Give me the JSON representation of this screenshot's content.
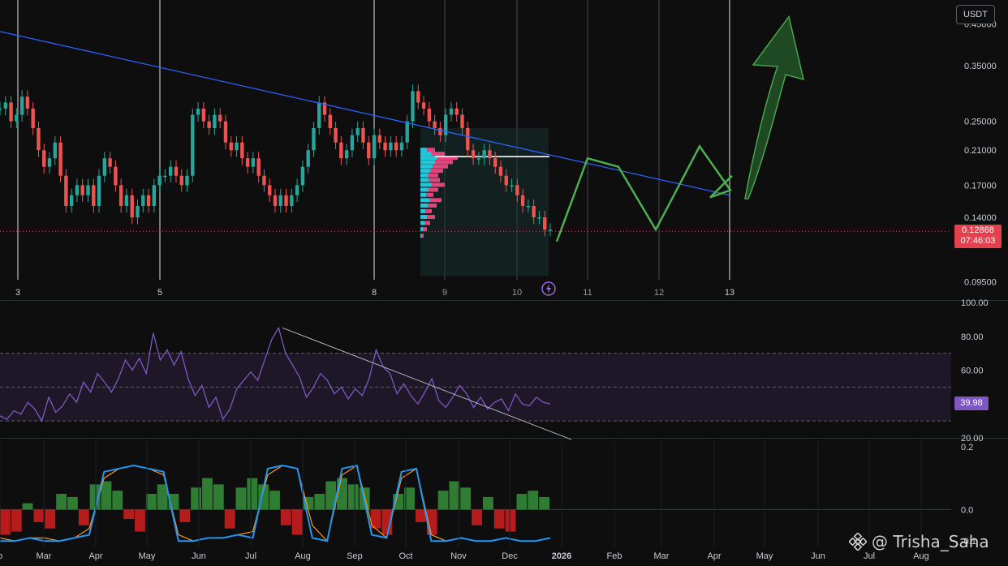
{
  "currency_label": "USDT",
  "price_badge": {
    "price": "0.12868",
    "countdown": "07:46:03",
    "color": "#e5404e"
  },
  "rsi_badge": {
    "value": "39.98",
    "color": "#7e57c2"
  },
  "watermark": {
    "text": "@ Trisha_Saha"
  },
  "chart_data": [
    {
      "type": "candlestick",
      "title": "",
      "yscale": "log",
      "ylim": [
        0.085,
        0.52
      ],
      "y_ticks": [
        "0.45000",
        "0.35000",
        "0.25000",
        "0.21000",
        "0.17000",
        "0.14000",
        "0.09500"
      ],
      "wave_labels": [
        "3",
        "5",
        "8",
        "9",
        "10",
        "11",
        "12",
        "13"
      ],
      "close_series": [
        0.27,
        0.28,
        0.25,
        0.26,
        0.29,
        0.27,
        0.24,
        0.21,
        0.19,
        0.2,
        0.22,
        0.18,
        0.15,
        0.16,
        0.17,
        0.16,
        0.17,
        0.15,
        0.18,
        0.2,
        0.19,
        0.17,
        0.15,
        0.16,
        0.14,
        0.15,
        0.16,
        0.15,
        0.17,
        0.18,
        0.18,
        0.19,
        0.18,
        0.17,
        0.18,
        0.26,
        0.27,
        0.25,
        0.24,
        0.26,
        0.25,
        0.22,
        0.21,
        0.22,
        0.2,
        0.19,
        0.2,
        0.18,
        0.17,
        0.16,
        0.15,
        0.16,
        0.15,
        0.16,
        0.17,
        0.19,
        0.21,
        0.24,
        0.28,
        0.26,
        0.24,
        0.22,
        0.2,
        0.21,
        0.23,
        0.24,
        0.22,
        0.2,
        0.23,
        0.22,
        0.21,
        0.22,
        0.21,
        0.22,
        0.25,
        0.3,
        0.28,
        0.27,
        0.25,
        0.24,
        0.23,
        0.26,
        0.27,
        0.26,
        0.24,
        0.21,
        0.2,
        0.2,
        0.21,
        0.2,
        0.19,
        0.18,
        0.17,
        0.17,
        0.16,
        0.15,
        0.15,
        0.14,
        0.14,
        0.13,
        0.13
      ],
      "current_price": 0.12868,
      "trendline": {
        "from": {
          "label": "start",
          "price": 0.43
        },
        "to": {
          "label": "13",
          "price": 0.16
        }
      },
      "volume_profile_poc": 0.202,
      "projection_path": [
        0.121,
        0.2,
        0.19,
        0.13,
        0.215,
        0.165,
        0.158,
        0.18
      ],
      "projection_arrow_target": 0.47,
      "colors": {
        "up": "#26a69a",
        "down": "#ef5350",
        "trendline": "#2962ff",
        "projection": "#4caf50"
      }
    },
    {
      "type": "line",
      "name": "RSI",
      "ylim": [
        20,
        100
      ],
      "y_ticks": [
        "100.00",
        "80.00",
        "60.00",
        "20.00"
      ],
      "bands": [
        70,
        50,
        30
      ],
      "values": [
        33,
        31,
        36,
        34,
        41,
        37,
        30,
        44,
        35,
        39,
        46,
        41,
        53,
        47,
        58,
        53,
        47,
        55,
        66,
        60,
        67,
        58,
        82,
        66,
        72,
        63,
        71,
        55,
        45,
        51,
        38,
        44,
        31,
        37,
        49,
        54,
        59,
        54,
        66,
        78,
        85,
        70,
        63,
        56,
        44,
        50,
        58,
        54,
        46,
        50,
        43,
        49,
        45,
        55,
        72,
        62,
        58,
        46,
        52,
        45,
        40,
        47,
        55,
        42,
        38,
        44,
        51,
        46,
        38,
        44,
        37,
        41,
        43,
        36,
        46,
        40,
        39,
        44,
        41,
        40
      ],
      "trendline": {
        "from": 85,
        "to": 30
      },
      "color": "#7e57c2"
    },
    {
      "type": "bar",
      "name": "Oscillator",
      "ylim": [
        -0.12,
        0.22
      ],
      "y_ticks": [
        "0.2",
        "0.0",
        "-0.1"
      ],
      "histogram": [
        -0.08,
        -0.07,
        0.02,
        -0.04,
        -0.06,
        0.05,
        0.04,
        -0.05,
        0.08,
        0.09,
        0.06,
        -0.03,
        -0.07,
        0.05,
        0.08,
        0.05,
        -0.04,
        0.07,
        0.1,
        0.08,
        -0.06,
        0.07,
        0.1,
        0.08,
        0.06,
        -0.05,
        -0.08,
        0.04,
        0.05,
        0.09,
        0.1,
        0.08,
        0.07,
        -0.06,
        -0.08,
        0.05,
        0.07,
        -0.04,
        -0.08,
        0.06,
        0.09,
        0.07,
        -0.05,
        0.04,
        -0.06,
        -0.07,
        0.05,
        0.06,
        0.04
      ],
      "fast_line": [
        -0.1,
        -0.1,
        -0.09,
        -0.1,
        -0.1,
        -0.09,
        -0.08,
        0.12,
        0.13,
        0.14,
        0.13,
        0.12,
        -0.1,
        -0.1,
        -0.09,
        -0.09,
        -0.08,
        -0.09,
        0.13,
        0.14,
        0.13,
        -0.09,
        -0.1,
        0.13,
        0.14,
        -0.08,
        -0.09,
        0.12,
        0.13,
        -0.1,
        -0.1,
        -0.09,
        -0.1,
        -0.1,
        -0.09,
        -0.1,
        -0.1,
        -0.09
      ],
      "slow_line": [
        -0.09,
        -0.1,
        -0.09,
        -0.09,
        -0.1,
        -0.09,
        -0.06,
        0.1,
        0.13,
        0.14,
        0.13,
        0.11,
        -0.08,
        -0.1,
        -0.09,
        -0.09,
        -0.08,
        -0.07,
        0.11,
        0.14,
        0.13,
        -0.05,
        -0.1,
        0.11,
        0.14,
        -0.05,
        -0.09,
        0.1,
        0.13,
        -0.08,
        -0.1,
        -0.09,
        -0.1,
        -0.1,
        -0.09,
        -0.1,
        -0.1,
        -0.09
      ],
      "x_ticks": [
        "b",
        "Mar",
        "Apr",
        "May",
        "Jun",
        "Jul",
        "Aug",
        "Sep",
        "Oct",
        "Nov",
        "Dec",
        "2026",
        "Feb",
        "Mar",
        "Apr",
        "May",
        "Jun",
        "Jul",
        "Aug"
      ],
      "colors": {
        "positive": "#2e7d32",
        "negative": "#b71c1c",
        "fast": "#2196f3",
        "slow": "#ff9800"
      }
    }
  ]
}
